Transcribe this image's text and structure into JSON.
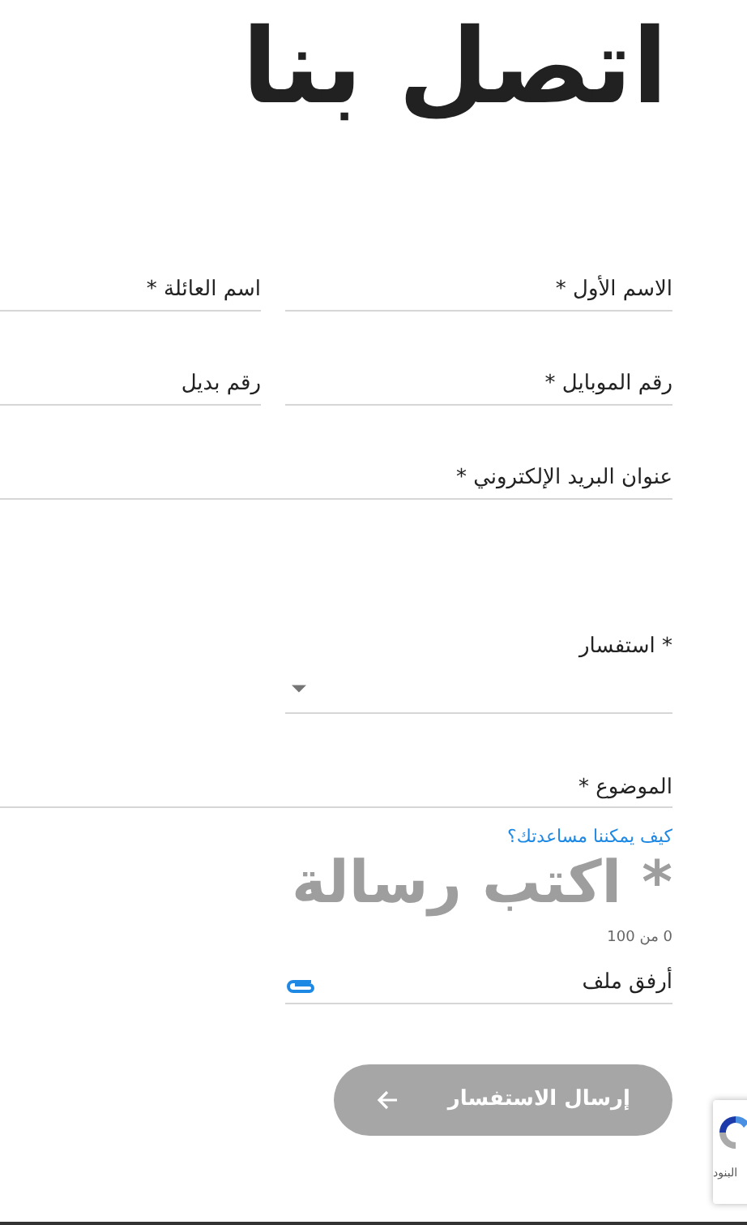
{
  "title": "اتصل بنا",
  "fields": [
    {
      "label": "الاسم الأول *",
      "kind": "half"
    },
    {
      "label": "اسم العائلة *",
      "kind": "half"
    },
    {
      "label": "رقم الموبايل *",
      "kind": "half"
    },
    {
      "label": "رقم بديل",
      "kind": "half"
    },
    {
      "label": "عنوان البريد الإلكتروني *",
      "kind": "full"
    }
  ],
  "inquiry": {
    "label": "* استفسار"
  },
  "subject": {
    "label": "الموضوع *"
  },
  "message": {
    "label": "كيف يمكننا مساعدتك؟",
    "placeholder": "* اكتب رسالة",
    "counter": "0 من 100"
  },
  "attachment": {
    "label": "أرفق ملف"
  },
  "submit": {
    "label": "إرسال الاستفسار",
    "disabled": true
  },
  "recaptcha": {
    "label": "البنود"
  }
}
